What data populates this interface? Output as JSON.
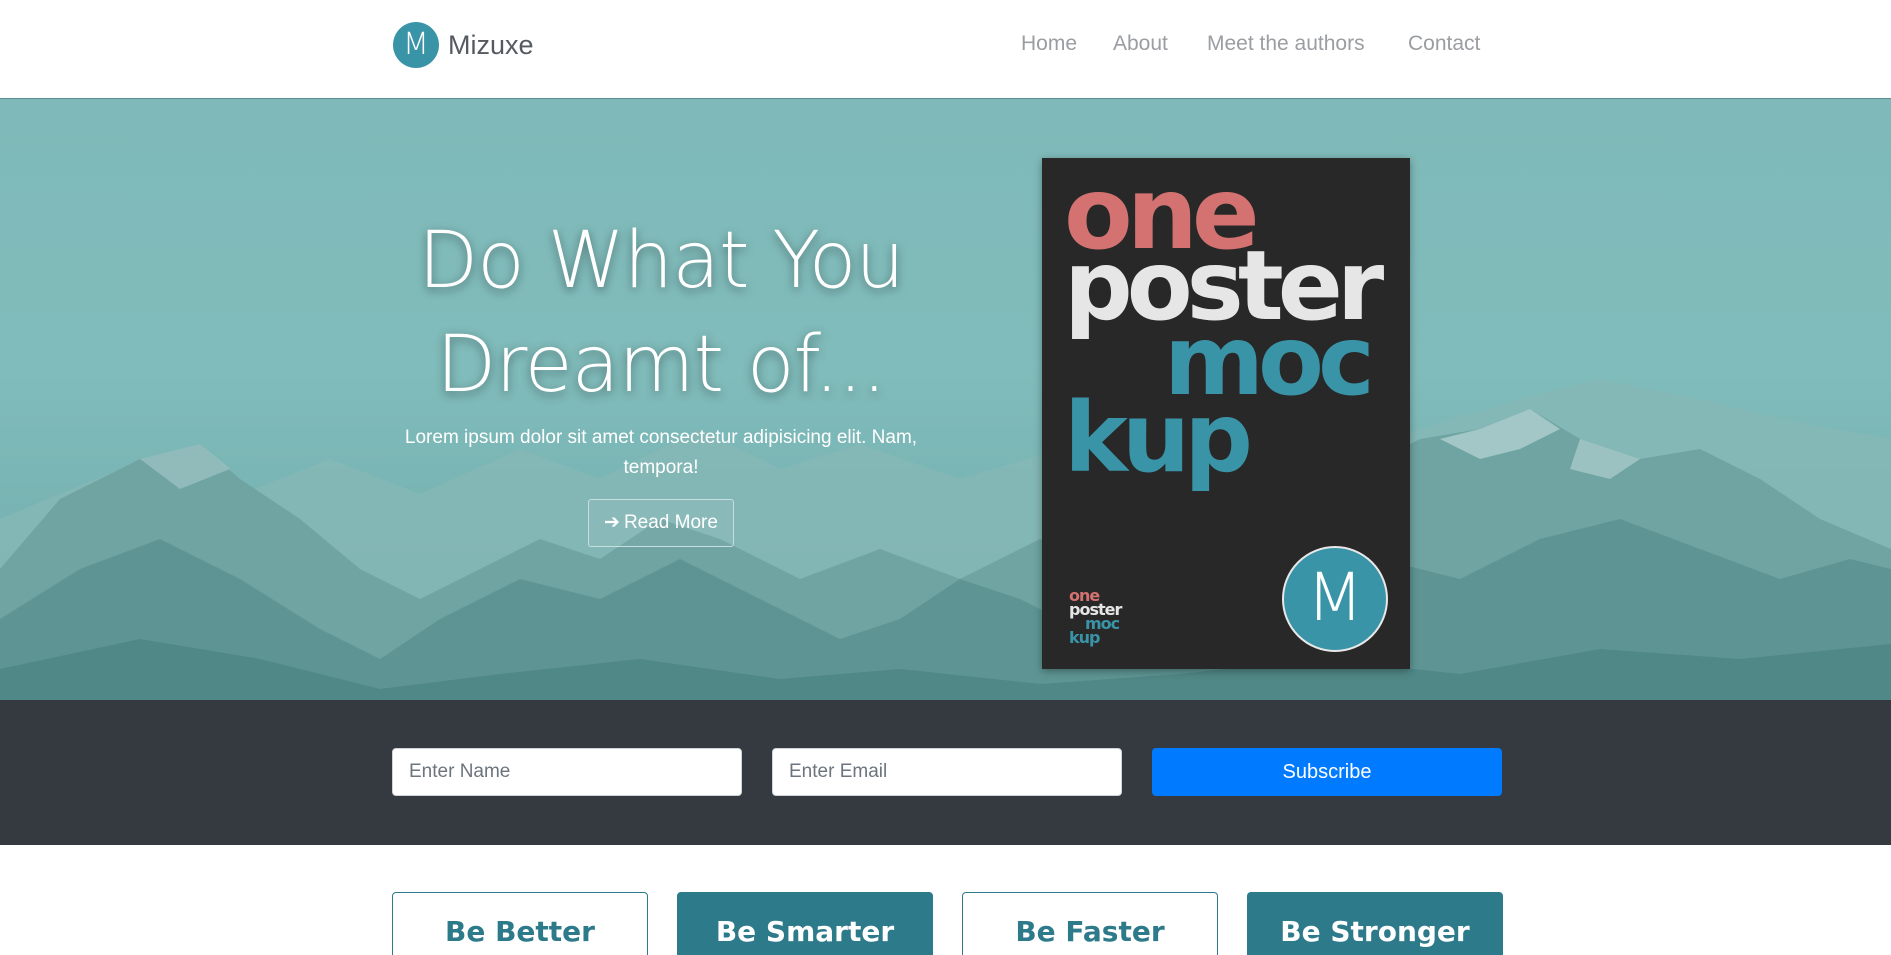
{
  "brand": {
    "logo_letter": "M",
    "name": "Mizuxe"
  },
  "nav": {
    "items": [
      {
        "label": "Home"
      },
      {
        "label": "About"
      },
      {
        "label": "Meet the authors"
      },
      {
        "label": "Contact"
      }
    ]
  },
  "hero": {
    "title_line1": "Do What You",
    "title_line2": "Dreamt of...",
    "subtitle": "Lorem ipsum dolor sit amet consectetur adipisicing elit. Nam, tempora!",
    "button_label": "Read More",
    "button_icon": "arrow-right-icon"
  },
  "poster": {
    "line1": "one",
    "line2": "poster",
    "line3": "moc",
    "line4": "kup",
    "small_line1": "one",
    "small_line2": "poster",
    "small_line3": "moc",
    "small_line4": "kup",
    "logo_letter": "M",
    "colors": {
      "one": "#d47272",
      "poster": "#e6e6e6",
      "mockup": "#3a94a8",
      "background": "#282828"
    }
  },
  "subscribe": {
    "name_placeholder": "Enter Name",
    "email_placeholder": "Enter Email",
    "button_label": "Subscribe"
  },
  "features": [
    {
      "label": "Be Better",
      "style": "outline"
    },
    {
      "label": "Be Smarter",
      "style": "filled"
    },
    {
      "label": "Be Faster",
      "style": "outline"
    },
    {
      "label": "Be Stronger",
      "style": "filled"
    }
  ],
  "colors": {
    "accent": "#3a94a8",
    "primary_button": "#007bff",
    "dark_bar": "#343a40",
    "feature": "#2d7a8a"
  }
}
